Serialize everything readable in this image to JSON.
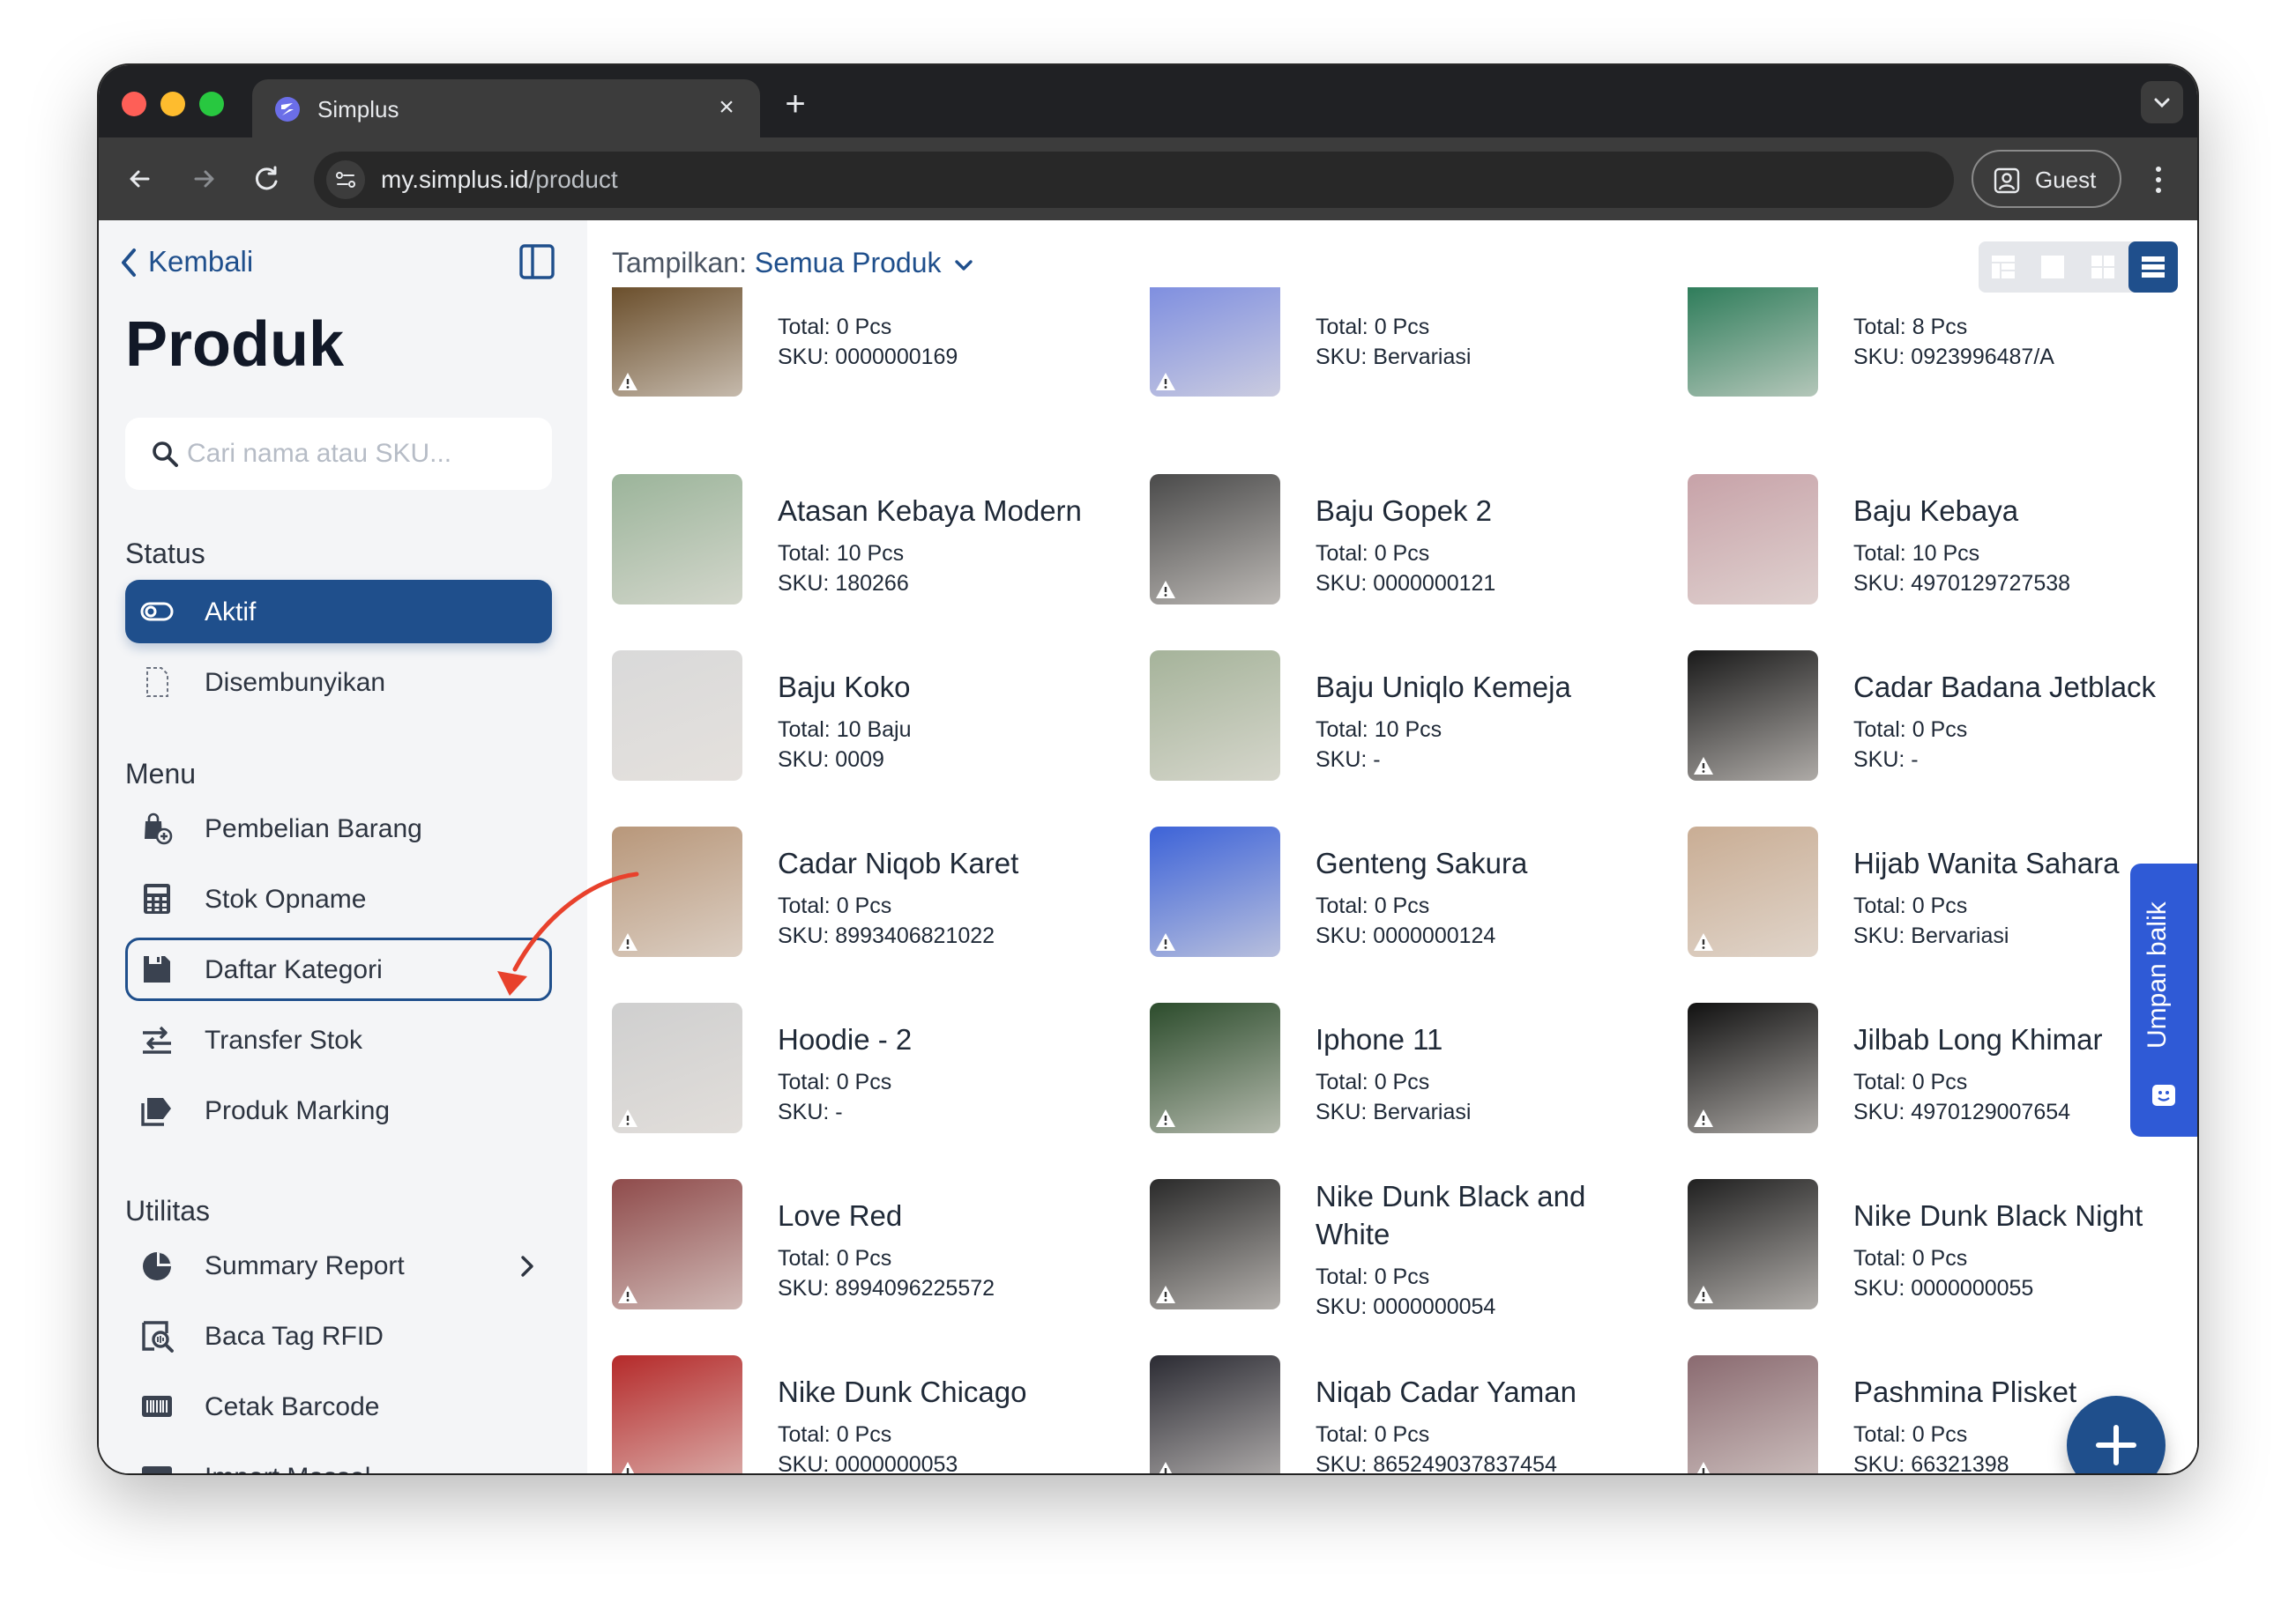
{
  "browser": {
    "tab_title": "Simplus",
    "url_host": "my.simplus.id",
    "url_path": "/product",
    "profile_label": "Guest"
  },
  "sidebar": {
    "back_label": "Kembali",
    "title": "Produk",
    "search_placeholder": "Cari nama atau SKU...",
    "status_heading": "Status",
    "status_items": [
      {
        "label": "Aktif",
        "icon": "toggle-icon",
        "active": true
      },
      {
        "label": "Disembunyikan",
        "icon": "hidden-doc-icon",
        "active": false
      }
    ],
    "menu_heading": "Menu",
    "menu_items": [
      {
        "label": "Pembelian Barang",
        "icon": "purchase-bag-icon"
      },
      {
        "label": "Stok Opname",
        "icon": "calculator-icon"
      },
      {
        "label": "Daftar Kategori",
        "icon": "save-icon",
        "highlighted": true
      },
      {
        "label": "Transfer Stok",
        "icon": "transfer-icon"
      },
      {
        "label": "Produk Marking",
        "icon": "tag-icon"
      }
    ],
    "utilities_heading": "Utilitas",
    "utility_items": [
      {
        "label": "Summary Report",
        "icon": "pie-chart-icon",
        "has_chevron": true
      },
      {
        "label": "Baca Tag RFID",
        "icon": "rfid-scan-icon"
      },
      {
        "label": "Cetak Barcode",
        "icon": "barcode-icon"
      },
      {
        "label": "Import Massal",
        "icon": "import-icon"
      }
    ]
  },
  "main": {
    "filter_label": "Tampilkan:",
    "filter_value": "Semua Produk",
    "products": [
      {
        "name": "",
        "total": "Total: 0 Pcs",
        "sku": "SKU: 0000000169",
        "thumb": "#6b4f2c",
        "warn": true
      },
      {
        "name": "",
        "total": "Total: 0 Pcs",
        "sku": "SKU: Bervariasi",
        "thumb": "#7f8fe0",
        "warn": true
      },
      {
        "name": "",
        "total": "Total: 8 Pcs",
        "sku": "SKU: 0923996487/A",
        "thumb": "#2f7d5b",
        "warn": false
      },
      {
        "name": "Atasan Kebaya Modern",
        "total": "Total: 10 Pcs",
        "sku": "SKU: 180266",
        "thumb": "#9bb49a",
        "warn": false
      },
      {
        "name": "Baju Gopek 2",
        "total": "Total: 0 Pcs",
        "sku": "SKU: 0000000121",
        "thumb": "#4a4a4a",
        "warn": true
      },
      {
        "name": "Baju Kebaya",
        "total": "Total: 10 Pcs",
        "sku": "SKU: 4970129727538",
        "thumb": "#c7a2a8",
        "warn": false
      },
      {
        "name": "Baju Koko",
        "total": "Total: 10 Baju",
        "sku": "SKU: 0009",
        "thumb": "#d9d9d9",
        "warn": false
      },
      {
        "name": "Baju Uniqlo Kemeja",
        "total": "Total: 10 Pcs",
        "sku": "SKU: -",
        "thumb": "#a5b39a",
        "warn": false
      },
      {
        "name": "Cadar Badana Jetblack",
        "total": "Total: 0 Pcs",
        "sku": "SKU: -",
        "thumb": "#1a1a1a",
        "warn": true
      },
      {
        "name": "Cadar Niqob Karet",
        "total": "Total: 0 Pcs",
        "sku": "SKU: 8993406821022",
        "thumb": "#b8977a",
        "warn": true
      },
      {
        "name": "Genteng Sakura",
        "total": "Total: 0 Pcs",
        "sku": "SKU: 0000000124",
        "thumb": "#3d63d8",
        "warn": true
      },
      {
        "name": "Hijab Wanita Sahara",
        "total": "Total: 0 Pcs",
        "sku": "SKU: Bervariasi",
        "thumb": "#c9ad94",
        "warn": true
      },
      {
        "name": "Hoodie - 2",
        "total": "Total: 0 Pcs",
        "sku": "SKU: -",
        "thumb": "#cfcfcf",
        "warn": true
      },
      {
        "name": "Iphone 11",
        "total": "Total: 0 Pcs",
        "sku": "SKU: Bervariasi",
        "thumb": "#2c4c2c",
        "warn": true
      },
      {
        "name": "Jilbab Long Khimar",
        "total": "Total: 0 Pcs",
        "sku": "SKU: 4970129007654",
        "thumb": "#111111",
        "warn": true
      },
      {
        "name": "Love Red",
        "total": "Total: 0 Pcs",
        "sku": "SKU: 8994096225572",
        "thumb": "#8f4b4b",
        "warn": true
      },
      {
        "name": "Nike Dunk Black and White",
        "total": "Total: 0 Pcs",
        "sku": "SKU: 0000000054",
        "thumb": "#2a2a2a",
        "warn": true
      },
      {
        "name": "Nike Dunk Black Night",
        "total": "Total: 0 Pcs",
        "sku": "SKU: 0000000055",
        "thumb": "#202020",
        "warn": true
      },
      {
        "name": "Nike Dunk Chicago",
        "total": "Total: 0 Pcs",
        "sku": "SKU: 0000000053",
        "thumb": "#b52a2a",
        "warn": true
      },
      {
        "name": "Niqab Cadar Yaman",
        "total": "Total: 0 Pcs",
        "sku": "SKU: 865249037837454",
        "thumb": "#2b2b33",
        "warn": true
      },
      {
        "name": "Pashmina Plisket",
        "total": "Total: 0 Pcs",
        "sku": "SKU: 66321398",
        "thumb": "#8a6a70",
        "warn": true
      }
    ]
  },
  "feedback_label": "Umpan balik",
  "colors": {
    "primary": "#1f4f8c",
    "feedback": "#2f5ad6",
    "annotation": "#e8412c"
  }
}
